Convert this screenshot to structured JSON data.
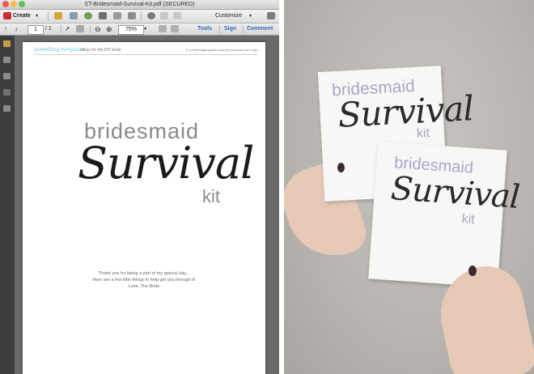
{
  "window": {
    "title": "ST-Bridesmaid-Survival-Kit.pdf (SECURED)"
  },
  "toolbar": {
    "create_label": "Create",
    "customize_label": "Customize",
    "page_current": "1",
    "page_total": "/ 1",
    "zoom_level": "75%",
    "tools_label": "Tools",
    "sign_label": "Sign",
    "comment_label": "Comment"
  },
  "document": {
    "header_logo": "something turquoise",
    "header_tagline": "ideas for the DIY bride",
    "header_right": "© somethingturquoise.com (for personal use only)",
    "title_line1": "bridesmaid",
    "title_script": "Survival",
    "title_line3": "kit",
    "message_line1": "Thank you for being a part of my special day...",
    "message_line2": "Here are a few little things to help get you through it!",
    "message_line3": "Love, The Bride"
  },
  "photo": {
    "card_back": {
      "line1": "bridesmaid",
      "script": "Survival",
      "line3": "kit"
    },
    "card_front": {
      "line1": "bridesmaid",
      "script": "Survival",
      "line3": "kit"
    }
  },
  "colors": {
    "accent_blue": "#2f6db5",
    "title_gray": "#8a8a8a",
    "card_lavender": "#a9a6c9",
    "logo_turquoise": "#5cc6c4"
  }
}
